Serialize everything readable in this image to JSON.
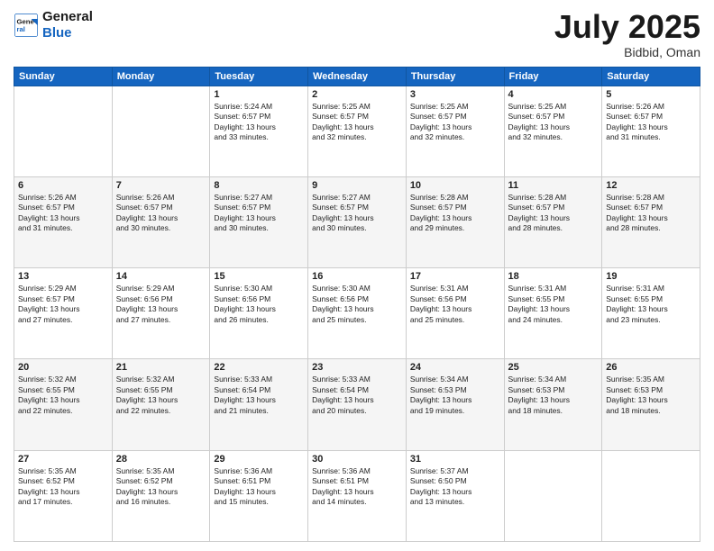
{
  "header": {
    "logo_line1": "General",
    "logo_line2": "Blue",
    "month": "July 2025",
    "location": "Bidbid, Oman"
  },
  "weekdays": [
    "Sunday",
    "Monday",
    "Tuesday",
    "Wednesday",
    "Thursday",
    "Friday",
    "Saturday"
  ],
  "weeks": [
    [
      {
        "day": "",
        "info": ""
      },
      {
        "day": "",
        "info": ""
      },
      {
        "day": "1",
        "info": "Sunrise: 5:24 AM\nSunset: 6:57 PM\nDaylight: 13 hours\nand 33 minutes."
      },
      {
        "day": "2",
        "info": "Sunrise: 5:25 AM\nSunset: 6:57 PM\nDaylight: 13 hours\nand 32 minutes."
      },
      {
        "day": "3",
        "info": "Sunrise: 5:25 AM\nSunset: 6:57 PM\nDaylight: 13 hours\nand 32 minutes."
      },
      {
        "day": "4",
        "info": "Sunrise: 5:25 AM\nSunset: 6:57 PM\nDaylight: 13 hours\nand 32 minutes."
      },
      {
        "day": "5",
        "info": "Sunrise: 5:26 AM\nSunset: 6:57 PM\nDaylight: 13 hours\nand 31 minutes."
      }
    ],
    [
      {
        "day": "6",
        "info": "Sunrise: 5:26 AM\nSunset: 6:57 PM\nDaylight: 13 hours\nand 31 minutes."
      },
      {
        "day": "7",
        "info": "Sunrise: 5:26 AM\nSunset: 6:57 PM\nDaylight: 13 hours\nand 30 minutes."
      },
      {
        "day": "8",
        "info": "Sunrise: 5:27 AM\nSunset: 6:57 PM\nDaylight: 13 hours\nand 30 minutes."
      },
      {
        "day": "9",
        "info": "Sunrise: 5:27 AM\nSunset: 6:57 PM\nDaylight: 13 hours\nand 30 minutes."
      },
      {
        "day": "10",
        "info": "Sunrise: 5:28 AM\nSunset: 6:57 PM\nDaylight: 13 hours\nand 29 minutes."
      },
      {
        "day": "11",
        "info": "Sunrise: 5:28 AM\nSunset: 6:57 PM\nDaylight: 13 hours\nand 28 minutes."
      },
      {
        "day": "12",
        "info": "Sunrise: 5:28 AM\nSunset: 6:57 PM\nDaylight: 13 hours\nand 28 minutes."
      }
    ],
    [
      {
        "day": "13",
        "info": "Sunrise: 5:29 AM\nSunset: 6:57 PM\nDaylight: 13 hours\nand 27 minutes."
      },
      {
        "day": "14",
        "info": "Sunrise: 5:29 AM\nSunset: 6:56 PM\nDaylight: 13 hours\nand 27 minutes."
      },
      {
        "day": "15",
        "info": "Sunrise: 5:30 AM\nSunset: 6:56 PM\nDaylight: 13 hours\nand 26 minutes."
      },
      {
        "day": "16",
        "info": "Sunrise: 5:30 AM\nSunset: 6:56 PM\nDaylight: 13 hours\nand 25 minutes."
      },
      {
        "day": "17",
        "info": "Sunrise: 5:31 AM\nSunset: 6:56 PM\nDaylight: 13 hours\nand 25 minutes."
      },
      {
        "day": "18",
        "info": "Sunrise: 5:31 AM\nSunset: 6:55 PM\nDaylight: 13 hours\nand 24 minutes."
      },
      {
        "day": "19",
        "info": "Sunrise: 5:31 AM\nSunset: 6:55 PM\nDaylight: 13 hours\nand 23 minutes."
      }
    ],
    [
      {
        "day": "20",
        "info": "Sunrise: 5:32 AM\nSunset: 6:55 PM\nDaylight: 13 hours\nand 22 minutes."
      },
      {
        "day": "21",
        "info": "Sunrise: 5:32 AM\nSunset: 6:55 PM\nDaylight: 13 hours\nand 22 minutes."
      },
      {
        "day": "22",
        "info": "Sunrise: 5:33 AM\nSunset: 6:54 PM\nDaylight: 13 hours\nand 21 minutes."
      },
      {
        "day": "23",
        "info": "Sunrise: 5:33 AM\nSunset: 6:54 PM\nDaylight: 13 hours\nand 20 minutes."
      },
      {
        "day": "24",
        "info": "Sunrise: 5:34 AM\nSunset: 6:53 PM\nDaylight: 13 hours\nand 19 minutes."
      },
      {
        "day": "25",
        "info": "Sunrise: 5:34 AM\nSunset: 6:53 PM\nDaylight: 13 hours\nand 18 minutes."
      },
      {
        "day": "26",
        "info": "Sunrise: 5:35 AM\nSunset: 6:53 PM\nDaylight: 13 hours\nand 18 minutes."
      }
    ],
    [
      {
        "day": "27",
        "info": "Sunrise: 5:35 AM\nSunset: 6:52 PM\nDaylight: 13 hours\nand 17 minutes."
      },
      {
        "day": "28",
        "info": "Sunrise: 5:35 AM\nSunset: 6:52 PM\nDaylight: 13 hours\nand 16 minutes."
      },
      {
        "day": "29",
        "info": "Sunrise: 5:36 AM\nSunset: 6:51 PM\nDaylight: 13 hours\nand 15 minutes."
      },
      {
        "day": "30",
        "info": "Sunrise: 5:36 AM\nSunset: 6:51 PM\nDaylight: 13 hours\nand 14 minutes."
      },
      {
        "day": "31",
        "info": "Sunrise: 5:37 AM\nSunset: 6:50 PM\nDaylight: 13 hours\nand 13 minutes."
      },
      {
        "day": "",
        "info": ""
      },
      {
        "day": "",
        "info": ""
      }
    ]
  ]
}
